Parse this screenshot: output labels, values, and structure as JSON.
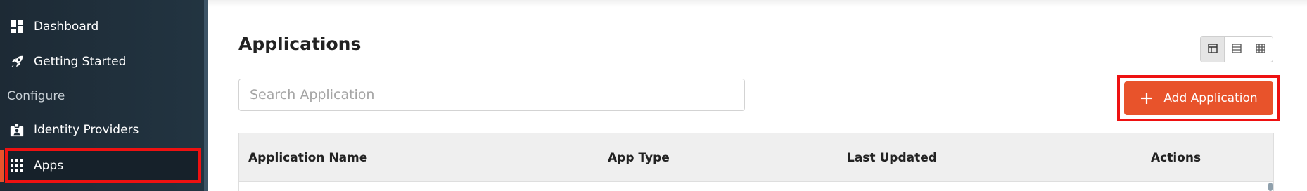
{
  "sidebar": {
    "items": [
      {
        "label": "Dashboard",
        "icon": "dashboard-icon"
      },
      {
        "label": "Getting Started",
        "icon": "rocket-icon"
      },
      {
        "label": "Identity Providers",
        "icon": "id-badge-icon"
      },
      {
        "label": "Apps",
        "icon": "apps-grid-icon",
        "active": true
      }
    ],
    "section_label": "Configure"
  },
  "main": {
    "title": "Applications",
    "search": {
      "placeholder": "Search Application",
      "value": ""
    },
    "add_button": {
      "label": "Add Application",
      "icon": "plus-icon"
    },
    "view_toggle": [
      "table-layout-icon",
      "list-layout-icon",
      "grid-layout-icon"
    ],
    "table": {
      "columns": [
        "Application Name",
        "App Type",
        "Last Updated",
        "Actions"
      ]
    }
  },
  "colors": {
    "accent": "#e8532b",
    "sidebar_bg": "#1d2a35",
    "highlight": "#ee1111"
  }
}
